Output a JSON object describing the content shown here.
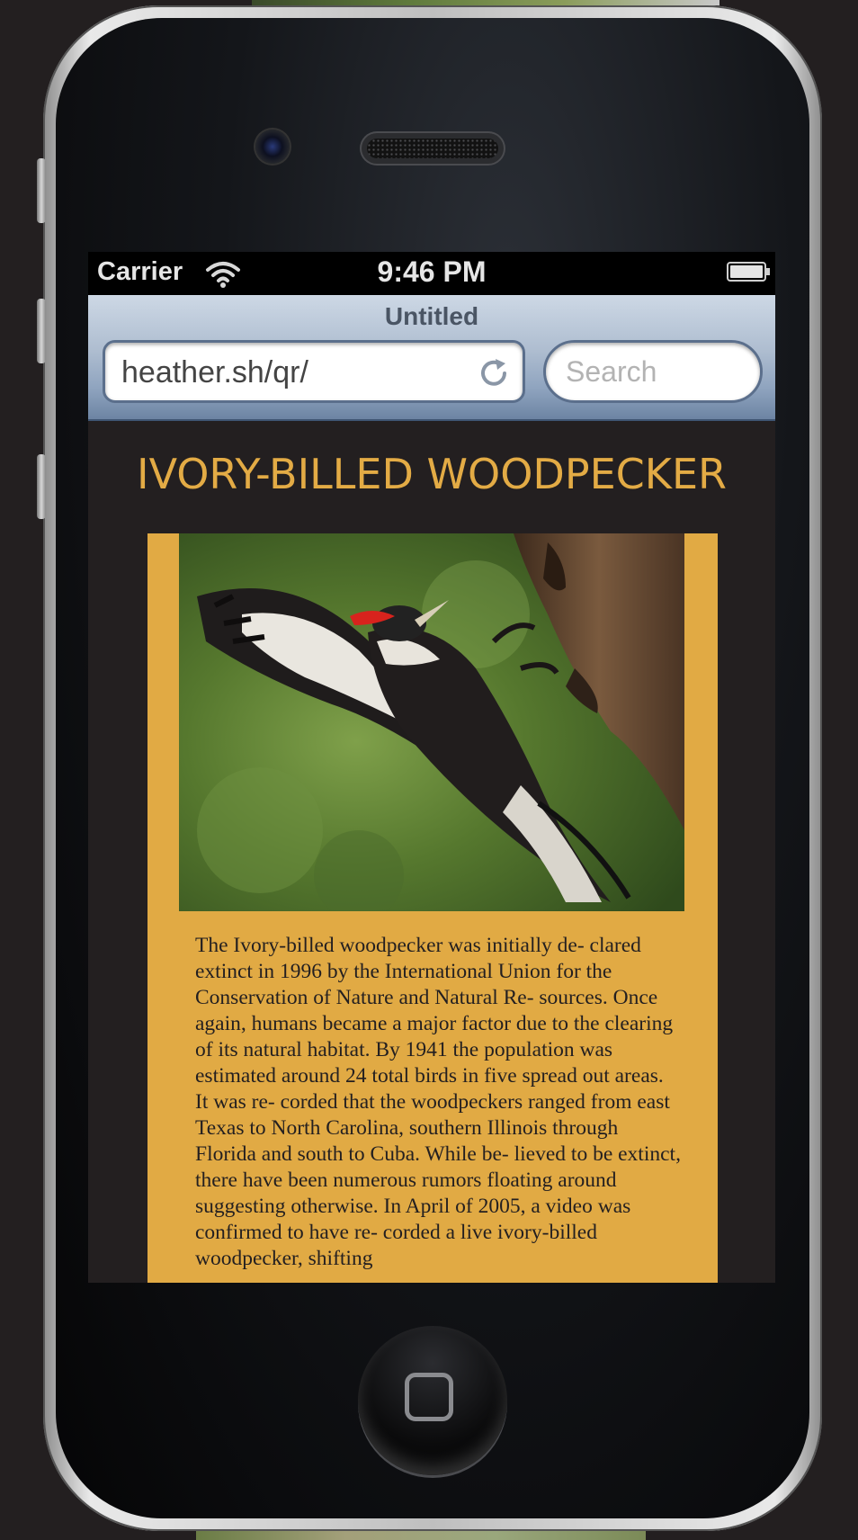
{
  "status_bar": {
    "carrier": "Carrier",
    "wifi_icon": "wifi-icon",
    "time": "9:46 PM",
    "battery_icon": "battery-icon"
  },
  "browser": {
    "title": "Untitled",
    "url": "heather.sh/qr/",
    "reload_icon": "reload-icon",
    "search_placeholder": "Search"
  },
  "article": {
    "headline": "IVORY-BILLED WOODPECKER",
    "body": "The Ivory-billed woodpecker was initially de- clared extinct in 1996 by the International Union for the Conservation of Nature and Natural Re- sources. Once again, humans became a major factor due to the clearing of its natural habitat. By 1941 the population was estimated around 24 total birds in five spread out areas. It was re- corded that the woodpeckers ranged from east Texas to North Carolina, southern Illinois through Florida and south to Cuba. While be- lieved to be extinct, there have been numerous rumors floating around suggesting otherwise. In April of 2005, a video was confirmed to have re- corded a live ivory-billed woodpecker, shifting"
  },
  "colors": {
    "accent": "#e3ab45",
    "card_background": "#e1aa44",
    "page_background": "#231f20"
  }
}
